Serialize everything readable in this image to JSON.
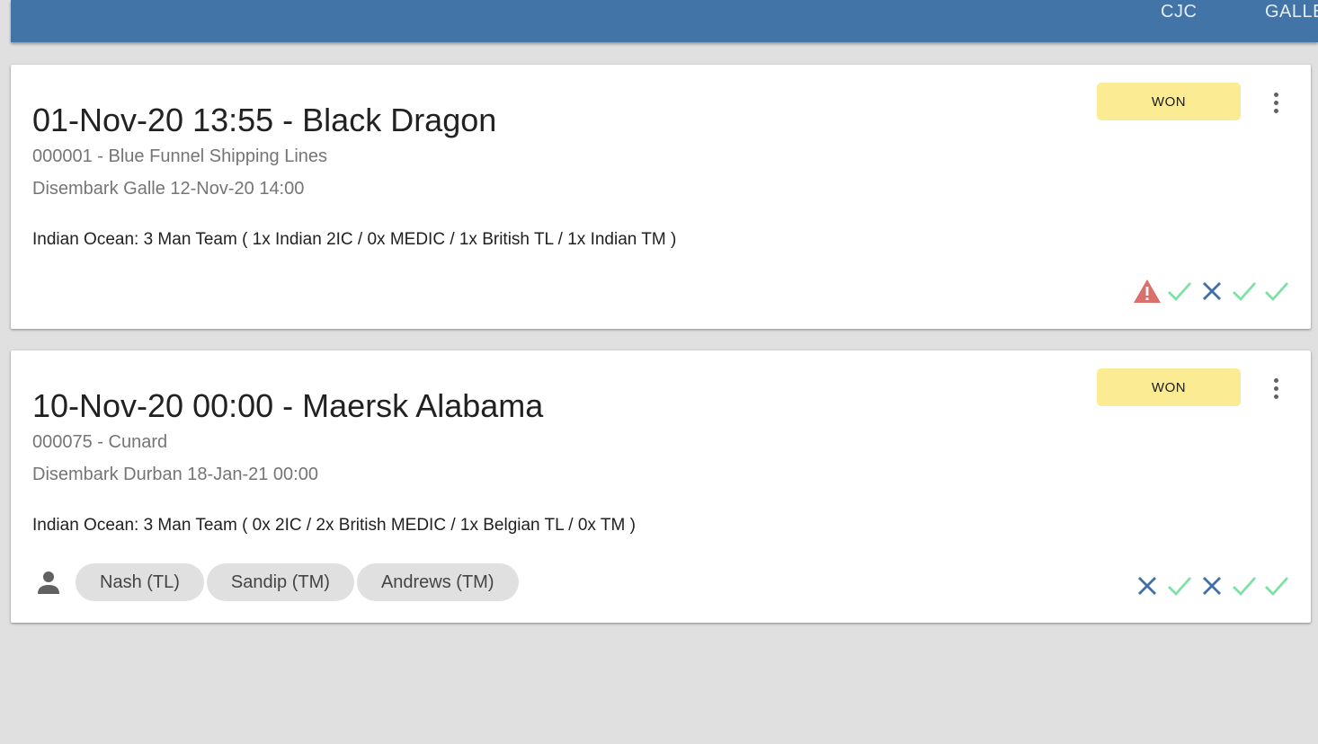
{
  "topbar": {
    "nav_items": [
      "CJC",
      "GALLE"
    ]
  },
  "colors": {
    "topbar": "#4274a8",
    "badge": "#fbec93",
    "check": "#7fe0a6",
    "cross": "#3f6fa6",
    "warning": "#d9706b"
  },
  "cards": [
    {
      "title": "01-Nov-20 13:55 - Black Dragon",
      "client": "000001 - Blue Funnel Shipping Lines",
      "disembark": "Disembark Galle 12-Nov-20 14:00",
      "team": "Indian Ocean: 3 Man Team ( 1x Indian 2IC / 0x MEDIC / 1x British TL / 1x Indian TM )",
      "status": "WON",
      "crew": [],
      "status_icons": [
        "warning-icon",
        "check-icon",
        "cross-icon",
        "check-icon",
        "check-icon"
      ]
    },
    {
      "title": "10-Nov-20 00:00 - Maersk Alabama",
      "client": "000075 - Cunard",
      "disembark": "Disembark Durban 18-Jan-21 00:00",
      "team": "Indian Ocean: 3 Man Team ( 0x 2IC / 2x British MEDIC / 1x Belgian TL / 0x TM )",
      "status": "WON",
      "crew": [
        "Nash (TL)",
        "Sandip (TM)",
        "Andrews (TM)"
      ],
      "status_icons": [
        "cross-icon",
        "check-icon",
        "cross-icon",
        "check-icon",
        "check-icon"
      ]
    }
  ]
}
